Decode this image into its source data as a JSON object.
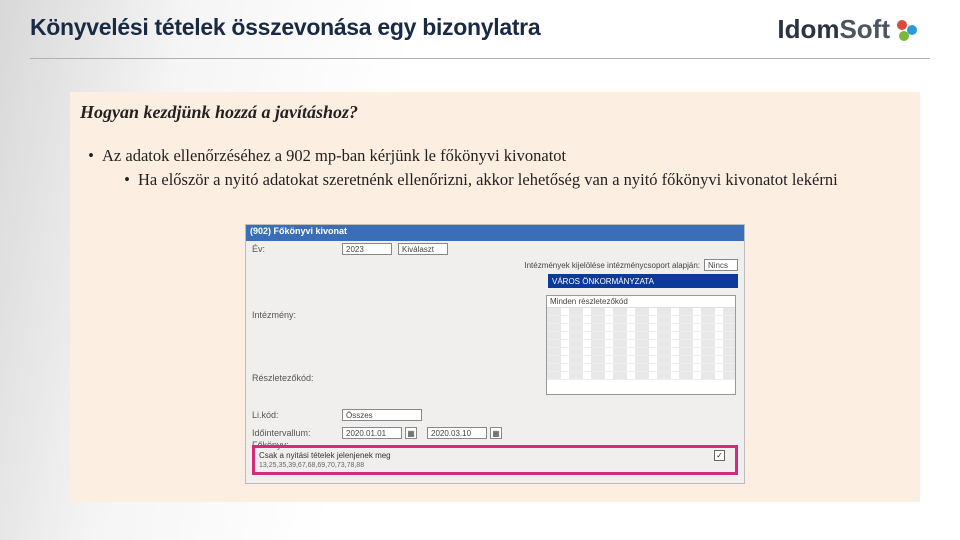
{
  "title": "Könyvelési tételek összevonása egy bizonylatra",
  "logo": {
    "brand_bold": "Idom",
    "brand_light": "Soft"
  },
  "panel": {
    "subhead": "Hogyan kezdjünk hozzá a javításhoz?",
    "bullet1": "Az adatok ellenőrzéséhez a 902 mp-ban kérjünk le főkönyvi kivonatot",
    "bullet2": "Ha először a nyitó adatokat szeretnénk ellenőrizni, akkor lehetőség van a nyitó főkönyvi kivonatot  lekérni"
  },
  "screenshot": {
    "window_title": "(902) Főkönyvi kivonat",
    "ev_label": "Év:",
    "ev_value": "2023",
    "kivalaszt_btn": "Kiválaszt",
    "intezmeny_group_label": "Intézmények kijelölése intézménycsoport alapján:",
    "nincs": "Nincs",
    "selected_org": "VÁROS ÖNKORMÁNYZATA",
    "intezmeny_label": "Intézmény:",
    "list_header": "Minden részletezőkód",
    "reszletezo_label": "Részletezőkód:",
    "li_kod_label": "Li.kód:",
    "osszes": "Összes",
    "idointervallum_label": "Időintervallum:",
    "date_from": "2020.01.01",
    "date_to": "2020.03.10",
    "fokonyv_label": "Főkönyv:",
    "highlight_text": "Csak a nyitási tételek jelenjenek meg",
    "highlight_sub": "13,25,35,39,67,68,69,70,73,78,88",
    "checkbox_checked": "✓"
  }
}
